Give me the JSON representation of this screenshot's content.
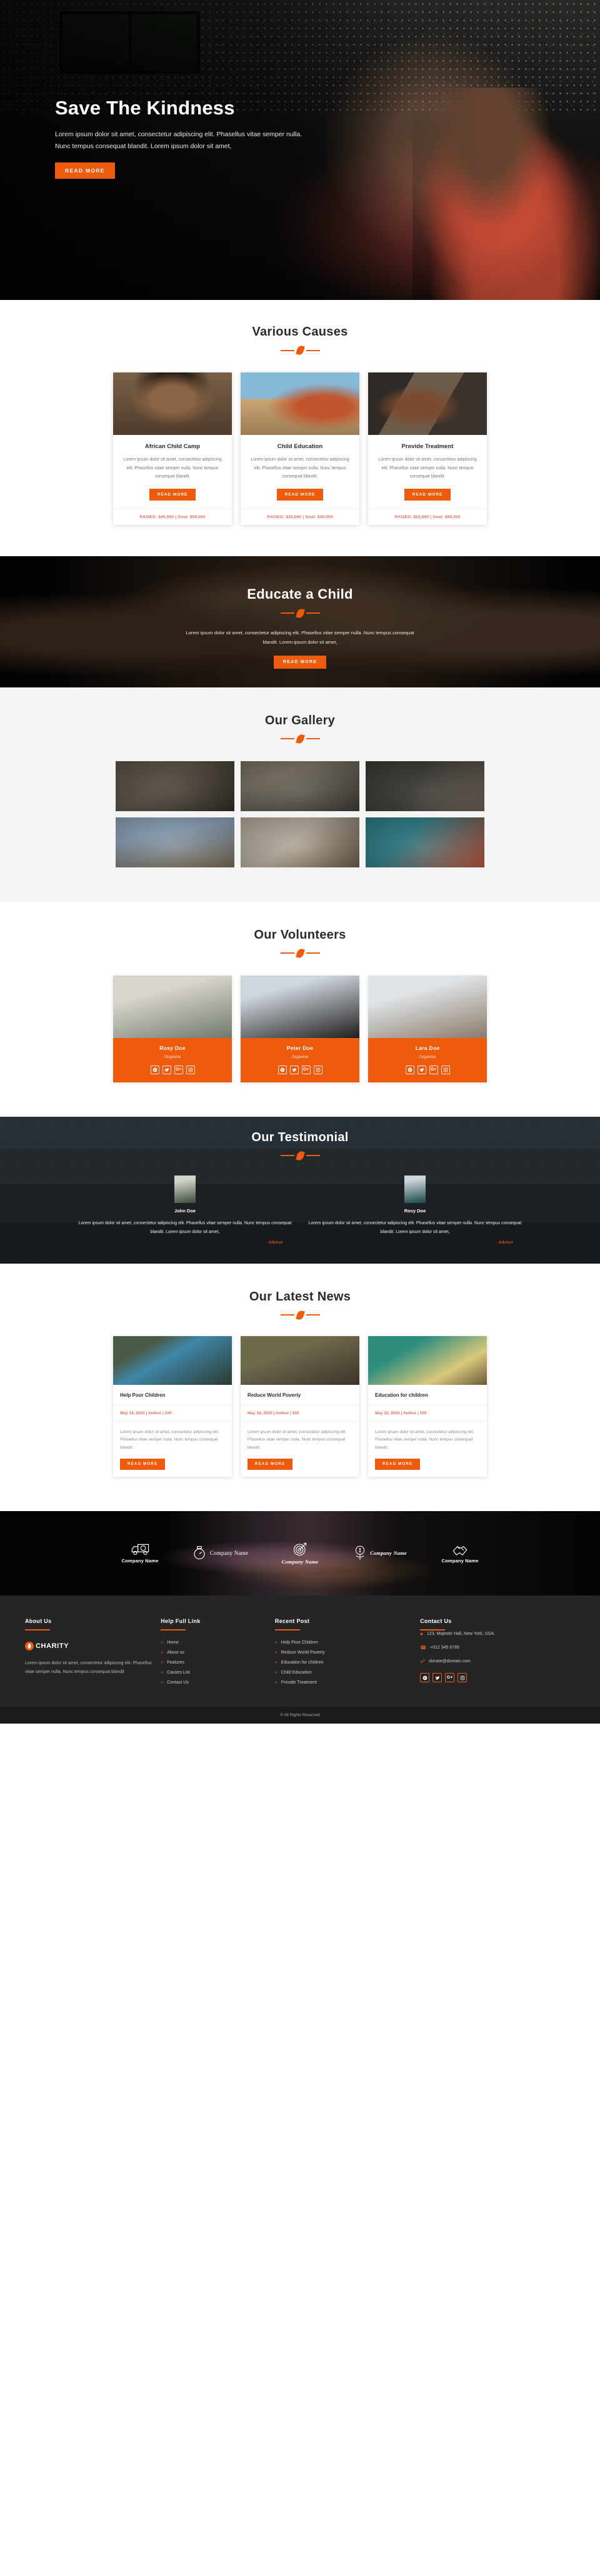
{
  "hero": {
    "title": "Save The Kindness",
    "subtitle": "Lorem ipsum dolor sit amet, consectetur adipiscing elit. Phasellus vitae semper nulla. Nunc tempus consequat blandit. Lorem ipsum dolor sit amet,",
    "cta": "READ MORE"
  },
  "causes": {
    "title": "Various Causes",
    "items": [
      {
        "name": "African Child Camp",
        "desc": "Lorem ipsum dolor sit amet, consectetur adipiscing elit. Phasellus vitae semper nulla. Nunc tempus consequat blandit.",
        "cta": "READ MORE",
        "funding": "RAISED: $40,000 | Goal: $50,000"
      },
      {
        "name": "Child Education",
        "desc": "Lorem ipsum dolor sit amet, consectetur adipiscing elit. Phasellus vitae semper nulla. Nunc tempus consequat blandit.",
        "cta": "READ MORE",
        "funding": "RAISED: $30,000 | Goal: $40,000"
      },
      {
        "name": "Provide Treatment",
        "desc": "Lorem ipsum dolor sit amet, consectetur adipiscing elit. Phasellus vitae semper nulla. Nunc tempus consequat blandit.",
        "cta": "READ MORE",
        "funding": "RAISED: $50,000 | Goal: $90,000"
      }
    ]
  },
  "educate": {
    "title": "Educate a Child",
    "desc": "Lorem ipsum dolor sit amet, consectetur adipiscing elit. Phasellus vitae semper nulla. Nunc tempus consequat blandit. Lorem ipsum dolor sit amet,",
    "cta": "READ MORE"
  },
  "gallery": {
    "title": "Our Gallery",
    "items": [
      {
        "caption": "children playing outdoors"
      },
      {
        "caption": "child on riverbank"
      },
      {
        "caption": "children with green bucket"
      },
      {
        "caption": "mother and child in field"
      },
      {
        "caption": "children with dolls"
      },
      {
        "caption": "children in blue room"
      }
    ]
  },
  "volunteers": {
    "title": "Our Volunteers",
    "items": [
      {
        "name": "Rosy Doe",
        "role": "Organise"
      },
      {
        "name": "Peter Doe",
        "role": "Organise"
      },
      {
        "name": "Lara Doe",
        "role": "Organise"
      }
    ],
    "socials": [
      "facebook-icon",
      "twitter-icon",
      "google-plus-icon",
      "instagram-icon"
    ]
  },
  "testimonial": {
    "title": "Our Testimonial",
    "items": [
      {
        "name": "John Doe",
        "text": "Lorem ipsum dolor sit amet, consectetur adipiscing elit. Phasellus vitae semper nulla. Nunc tempus consequat blandit. Lorem ipsum dolor sit amet,",
        "role": "- Advisor"
      },
      {
        "name": "Rosy Doe",
        "text": "Lorem ipsum dolor sit amet, consectetur adipiscing elit. Phasellus vitae semper nulla. Nunc tempus consequat blandit. Lorem ipsum dolor sit amet,",
        "role": "- Advisor"
      }
    ]
  },
  "news": {
    "title": "Our Latest News",
    "items": [
      {
        "title": "Help Poor Children",
        "meta": "May 14, 2020 | Author | 100",
        "desc": "Lorem ipsum dolor sit amet, consectetur adipiscing elit. Phasellus vitae semper nulla. Nunc tempus consequat blandit.",
        "cta": "READ MORE"
      },
      {
        "title": "Reduce World Poverty",
        "meta": "May 18, 2020 | Author | 100",
        "desc": "Lorem ipsum dolor sit amet, consectetur adipiscing elit. Phasellus vitae semper nulla. Nunc tempus consequat blandit.",
        "cta": "READ MORE"
      },
      {
        "title": "Education for children",
        "meta": "May 22, 2020 | Author | 100",
        "desc": "Lorem ipsum dolor sit amet, consectetur adipiscing elit. Phasellus vitae semper nulla. Nunc tempus consequat blandit.",
        "cta": "READ MORE"
      }
    ]
  },
  "brands": {
    "items": [
      {
        "name": "Company Name",
        "icon": "delivery-truck-24-icon"
      },
      {
        "name": "Company Name",
        "icon": "stopwatch-icon"
      },
      {
        "name": "Company Name",
        "icon": "target-arrow-icon"
      },
      {
        "name": "Company Name",
        "icon": "money-plant-icon"
      },
      {
        "name": "Company Name",
        "icon": "handshake-icon"
      }
    ]
  },
  "footer": {
    "about": {
      "heading": "About Us",
      "brand": "CHARITY",
      "text": "Lorem ipsum dolor sit amet, consectetur adipiscing elit. Phasellus vitae semper nulla. Nunc tempus consequat blandit"
    },
    "help": {
      "heading": "Help Full Link",
      "links": [
        "Home",
        "About us",
        "Features",
        "Causes List",
        "Contact Us"
      ]
    },
    "recent": {
      "heading": "Recent Post",
      "links": [
        "Help Poor Children",
        "Reduce World Poverty",
        "Education for children",
        "Child Education",
        "Provide Treatment"
      ]
    },
    "contact": {
      "heading": "Contact Us",
      "address": "123, Majestic Hall, New York, USA.",
      "phone": "+012 345 6789",
      "email": "donate@domain.com",
      "socials": [
        "facebook-icon",
        "twitter-icon",
        "google-plus-icon",
        "instagram-icon"
      ]
    },
    "copyright": "© All Rights Reserved"
  }
}
